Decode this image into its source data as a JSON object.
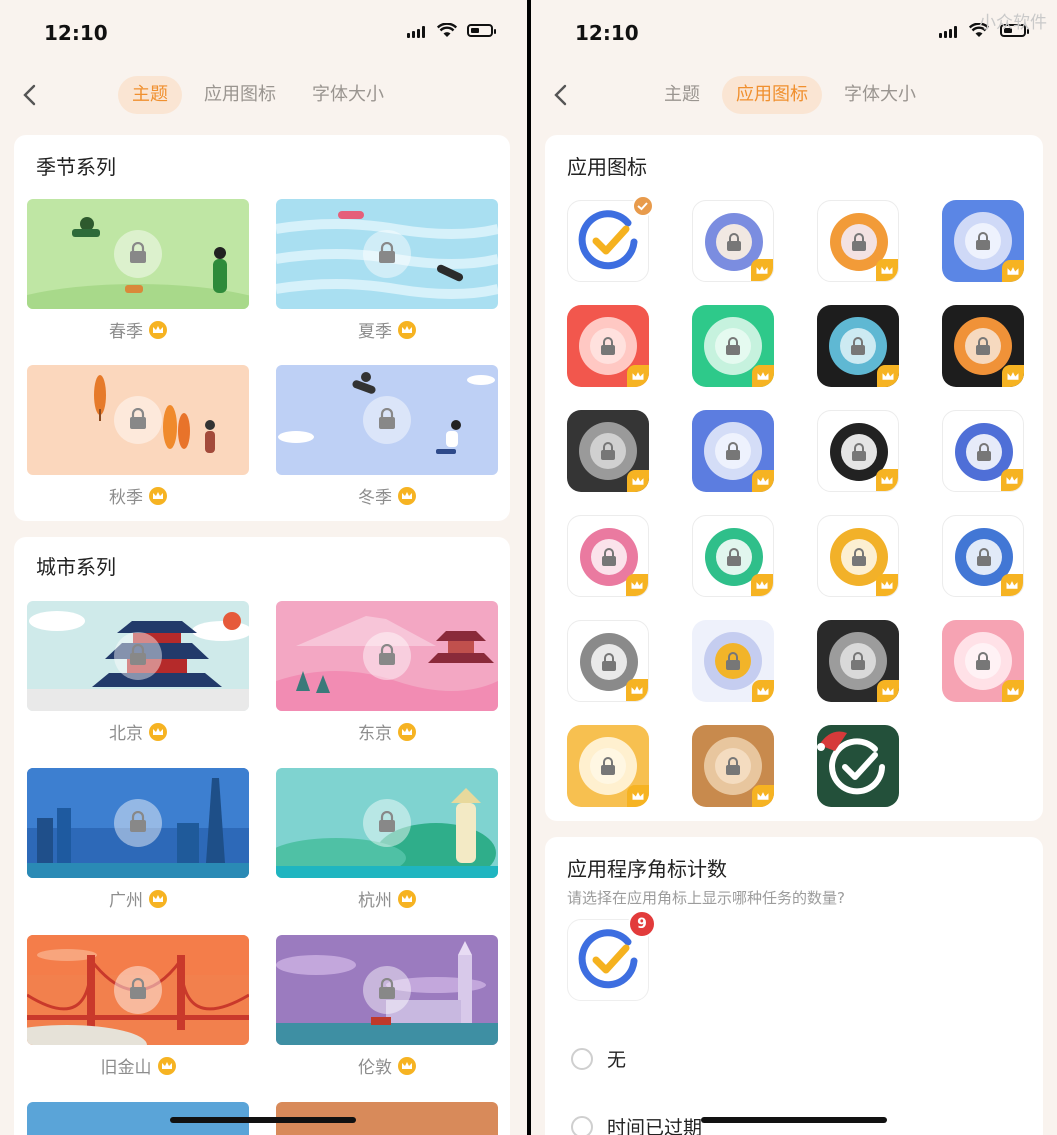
{
  "status": {
    "time": "12:10"
  },
  "tabs": {
    "theme": "主题",
    "app_icon": "应用图标",
    "font_size": "字体大小"
  },
  "left": {
    "seasons": {
      "title": "季节系列",
      "items": [
        "春季",
        "夏季",
        "秋季",
        "冬季"
      ]
    },
    "cities": {
      "title": "城市系列",
      "items": [
        "北京",
        "东京",
        "广州",
        "杭州",
        "旧金山",
        "伦敦"
      ]
    }
  },
  "right": {
    "watermark": "小众软件",
    "icons_title": "应用图标",
    "badge": {
      "title": "应用程序角标计数",
      "subtitle": "请选择在应用角标上显示哪种任务的数量?",
      "count": "9",
      "options": [
        "无",
        "时间已过期"
      ]
    }
  },
  "colors": {
    "accent": "#f0902f",
    "crown": "#f6b322",
    "badge_red": "#e23b3b"
  }
}
